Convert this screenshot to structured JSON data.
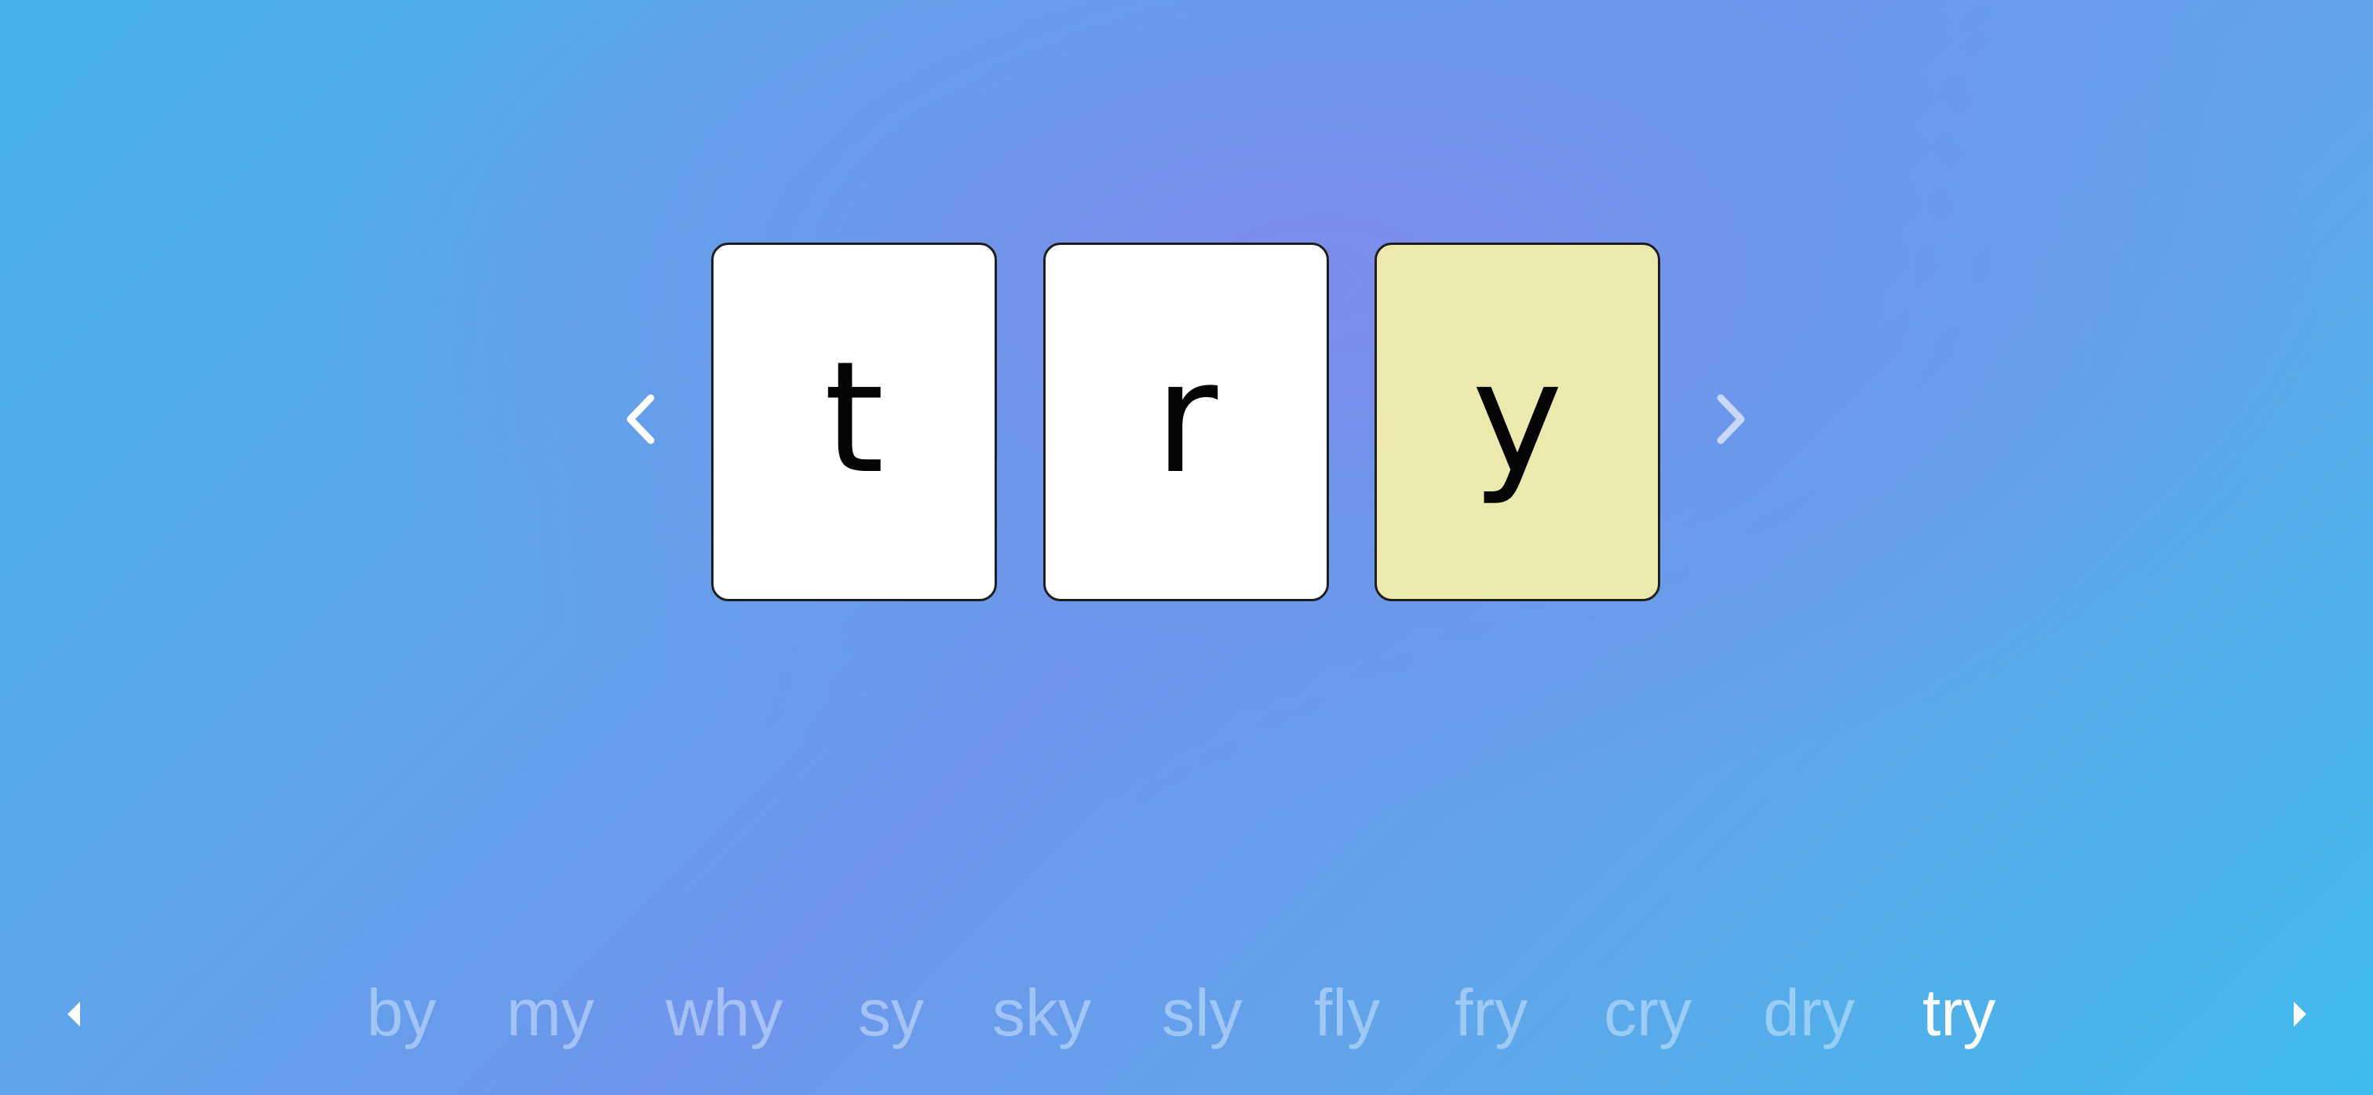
{
  "navigation": {
    "prev_icon": "chevron-left-icon",
    "next_icon": "chevron-right-icon",
    "prev_color": "#ffffff",
    "next_color": "#c9d8f8"
  },
  "tiles": [
    {
      "letter": "t",
      "color": "#ffffff"
    },
    {
      "letter": "r",
      "color": "#ffffff"
    },
    {
      "letter": "y",
      "color": "#ede8ad"
    }
  ],
  "word_list": {
    "prev_icon": "caret-left-icon",
    "next_icon": "caret-right-icon",
    "words": [
      "by",
      "my",
      "why",
      "sy",
      "sky",
      "sly",
      "fly",
      "fry",
      "cry",
      "dry",
      "try"
    ],
    "active_index": 10,
    "active_word": "try"
  }
}
